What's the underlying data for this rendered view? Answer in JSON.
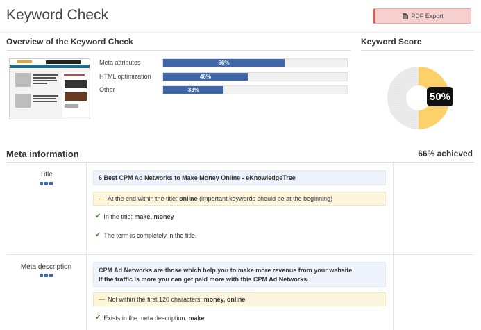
{
  "header": {
    "title": "Keyword Check",
    "pdf_export_label": "PDF Export"
  },
  "overview": {
    "heading": "Overview of the Keyword Check",
    "metrics": [
      {
        "label": "Meta attributes",
        "value": 66,
        "display": "66%"
      },
      {
        "label": "HTML optimization",
        "value": 46,
        "display": "46%"
      },
      {
        "label": "Other",
        "value": 33,
        "display": "33%"
      }
    ]
  },
  "keyword_score": {
    "heading": "Keyword Score",
    "value": 50,
    "display": "50%",
    "colors": {
      "filled": "#fdd16a",
      "empty": "#e8e8e8",
      "badge": "#111111"
    }
  },
  "meta_information": {
    "heading": "Meta information",
    "achieved": "66% achieved",
    "rows": [
      {
        "label": "Title",
        "value_text": "6 Best CPM Ad Networks to Make Money Online - eKnowledgeTree",
        "warning_prefix": "At the end within the title: ",
        "warning_keyword": "online",
        "warning_suffix": " (important keywords should be at the beginning)",
        "checks": [
          {
            "prefix": "In the title: ",
            "bold": "make, money"
          },
          {
            "prefix": "The term is completely in the title.",
            "bold": ""
          }
        ]
      },
      {
        "label": "Meta description",
        "value_line1": "CPM Ad Networks are those which help you to make more revenue from your website.",
        "value_line2": "If the traffic is more you can get paid more with this CPM Ad Networks.",
        "warning_prefix": "Not within the first 120 characters: ",
        "warning_keyword": "money, online",
        "checks": [
          {
            "prefix": "Exists in the meta description: ",
            "bold": "make"
          }
        ]
      }
    ]
  },
  "icons": {
    "pdf": "document-icon",
    "check": "checkmark-icon",
    "warning": "dash-icon",
    "rating": "rating-dots-icon"
  },
  "colors": {
    "accent_blue": "#3f67a8",
    "pdf_button_bg": "#f6cfcf",
    "warning_bg": "#fdf6df",
    "info_bg": "#eef3fb",
    "check_green": "#4a8a3a"
  }
}
